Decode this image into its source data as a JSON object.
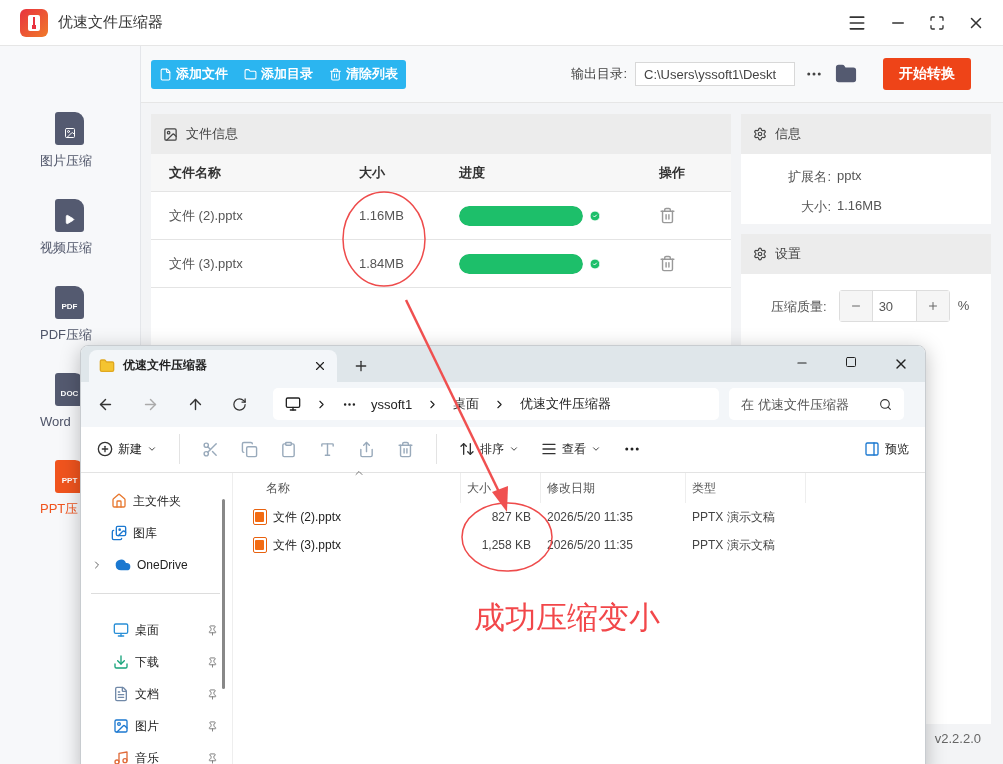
{
  "app": {
    "title": "优速文件压缩器",
    "version": "v2.2.2.0"
  },
  "sidebar": [
    {
      "label": "图片压缩",
      "kind": "image",
      "selected": false
    },
    {
      "label": "视频压缩",
      "kind": "video",
      "selected": false
    },
    {
      "label": "PDF压缩",
      "kind": "badge",
      "badge": "PDF",
      "selected": false
    },
    {
      "label": "Word",
      "kind": "badge",
      "badge": "DOC",
      "selected": false
    },
    {
      "label": "PPT压",
      "kind": "badge",
      "badge": "PPT",
      "selected": true
    }
  ],
  "toolbar": {
    "buttons": [
      {
        "label": "添加文件",
        "kind": "file"
      },
      {
        "label": "添加目录",
        "kind": "folder"
      },
      {
        "label": "清除列表",
        "kind": "trash"
      }
    ],
    "output_label": "输出目录:",
    "output_path": "C:\\Users\\yssoft1\\Deskt",
    "start": "开始转换"
  },
  "file_panel": {
    "title": "文件信息",
    "columns": [
      "文件名称",
      "大小",
      "进度",
      "操作"
    ],
    "rows": [
      {
        "name": "文件 (2).pptx",
        "size": "1.16MB",
        "level": 1,
        "done": true
      },
      {
        "name": "文件 (3).pptx",
        "size": "1.84MB",
        "level": 1,
        "done": true
      }
    ]
  },
  "info_panel": {
    "title": "信息",
    "fields": [
      {
        "label": "扩展名:",
        "value": "pptx"
      },
      {
        "label": "大小:",
        "value": "1.16MB"
      }
    ]
  },
  "settings_panel": {
    "title": "设置",
    "quality_label": "压缩质量:",
    "quality": "30",
    "unit": "%"
  },
  "explorer": {
    "tab": "优速文件压缩器",
    "breadcrumb": [
      "yssoft1",
      "桌面",
      "优速文件压缩器"
    ],
    "search_placeholder": "在 优速文件压缩器",
    "commands": [
      {
        "label": "新建",
        "kind": "new"
      },
      {
        "label": "排序",
        "kind": "sort"
      },
      {
        "label": "查看",
        "kind": "view"
      }
    ],
    "preview": "预览",
    "nav_top": [
      {
        "label": "主文件夹",
        "kind": "home"
      },
      {
        "label": "图库",
        "kind": "gallery"
      },
      {
        "label": "OneDrive",
        "kind": "cloud"
      }
    ],
    "nav_pinned": [
      {
        "label": "桌面",
        "kind": "desktop"
      },
      {
        "label": "下载",
        "kind": "download"
      },
      {
        "label": "文档",
        "kind": "docs"
      },
      {
        "label": "图片",
        "kind": "pictures"
      },
      {
        "label": "音乐",
        "kind": "music"
      }
    ],
    "columns": [
      "名称",
      "大小",
      "修改日期",
      "类型"
    ],
    "files": [
      {
        "name": "文件 (2).pptx",
        "size": "827 KB",
        "modified": "2026/5/20 11:35",
        "type": "PPTX 演示文稿"
      },
      {
        "name": "文件 (3).pptx",
        "size": "1,258 KB",
        "modified": "2026/5/20 11:35",
        "type": "PPTX 演示文稿"
      }
    ]
  },
  "annotation": "成功压缩变小"
}
